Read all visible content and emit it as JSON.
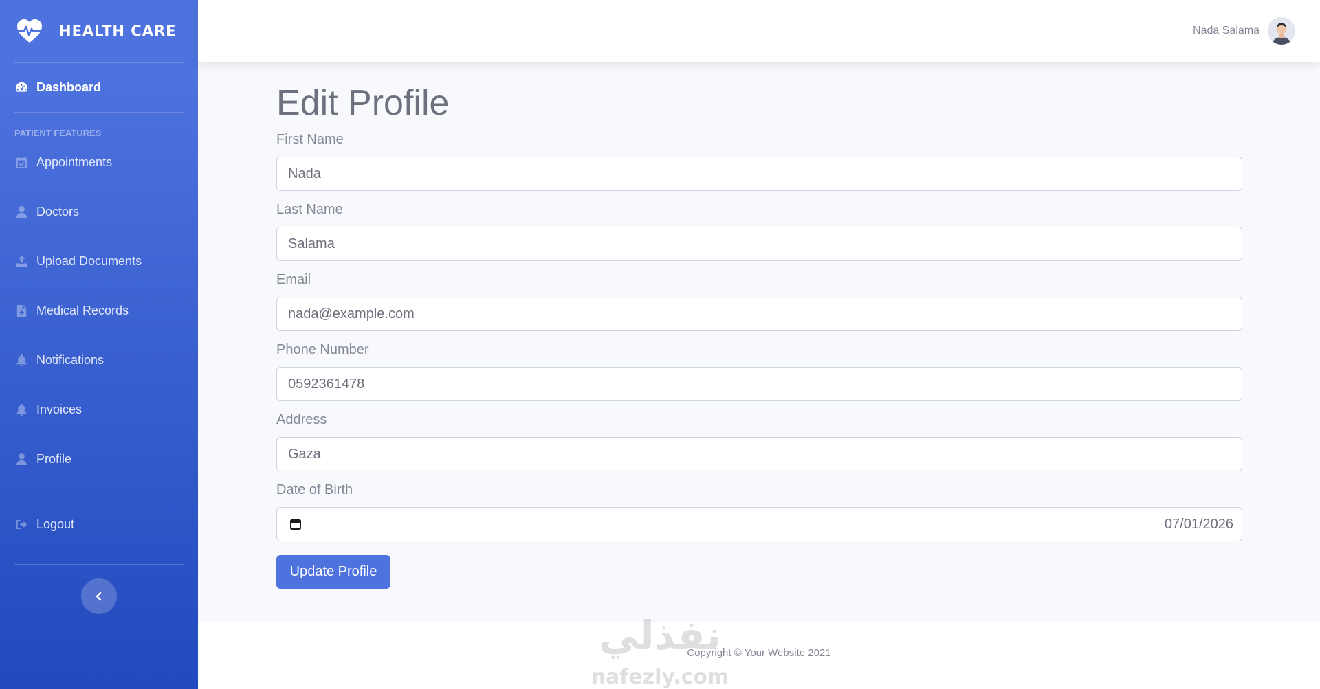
{
  "brand": {
    "name": "HEALTH CARE"
  },
  "sidebar": {
    "dashboard": "Dashboard",
    "section_heading": "PATIENT FEATURES",
    "items": [
      {
        "label": "Appointments",
        "icon": "calendar-check-icon"
      },
      {
        "label": "Doctors",
        "icon": "user-md-icon"
      },
      {
        "label": "Upload Documents",
        "icon": "upload-icon"
      },
      {
        "label": "Medical Records",
        "icon": "file-medical-icon"
      },
      {
        "label": "Notifications",
        "icon": "bell-icon"
      },
      {
        "label": "Invoices",
        "icon": "bell-icon"
      },
      {
        "label": "Profile",
        "icon": "user-icon"
      }
    ],
    "logout": "Logout"
  },
  "topbar": {
    "user_name": "Nada Salama"
  },
  "page": {
    "title": "Edit Profile"
  },
  "form": {
    "first_name": {
      "label": "First Name",
      "value": "Nada"
    },
    "last_name": {
      "label": "Last Name",
      "value": "Salama"
    },
    "email": {
      "label": "Email",
      "value": "nada@example.com"
    },
    "phone": {
      "label": "Phone Number",
      "value": "0592361478"
    },
    "address": {
      "label": "Address",
      "value": "Gaza"
    },
    "dob": {
      "label": "Date of Birth",
      "value": "07/01/2026"
    },
    "submit": "Update Profile"
  },
  "footer": {
    "copyright": "Copyright © Your Website 2021"
  },
  "watermark": {
    "arabic": "نفذلي",
    "latin": "nafezly.com"
  },
  "colors": {
    "primary": "#4e73df",
    "primary_dark": "#224abe",
    "text": "#858796",
    "background": "#f8f9fc"
  }
}
